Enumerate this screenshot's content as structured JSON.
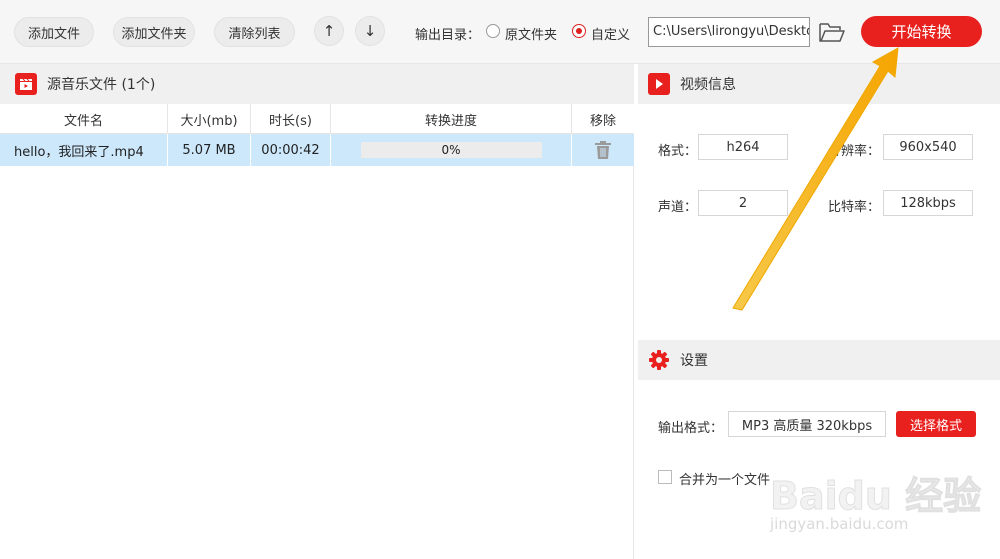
{
  "toolbar": {
    "add_file": "添加文件",
    "add_folder": "添加文件夹",
    "clear_list": "清除列表",
    "move_up_icon": "arrow-up-icon",
    "move_down_icon": "arrow-down-icon",
    "output_dir_label": "输出目录：",
    "radio_original": "原文件夹",
    "radio_custom": "自定义",
    "selected_radio": "custom",
    "output_path": "C:\\Users\\lirongyu\\Desktop",
    "folder_icon": "folder-open-icon",
    "start_button": "开始转换"
  },
  "source_files": {
    "title": "源音乐文件 (1个)",
    "icon": "video-clapper-icon",
    "columns": [
      "文件名",
      "大小(mb)",
      "时长(s)",
      "转换进度",
      "移除"
    ],
    "rows": [
      {
        "name": "hello，我回来了.mp4",
        "size": "5.07 MB",
        "duration": "00:00:42",
        "progress_text": "0%",
        "progress": 0,
        "remove_icon": "trash-icon"
      }
    ]
  },
  "video_info": {
    "title": "视频信息",
    "icon": "play-icon",
    "format_label": "格式：",
    "format_value": "h264",
    "resolution_label": "分辨率：",
    "resolution_value": "960x540",
    "channels_label": "声道：",
    "channels_value": "2",
    "bitrate_label": "比特率：",
    "bitrate_value": "128kbps"
  },
  "settings": {
    "title": "设置",
    "icon": "gear-icon",
    "output_format_label": "输出格式：",
    "output_format_value": "MP3 高质量 320kbps",
    "choose_format_button": "选择格式",
    "merge_label": "合并为一个文件",
    "merge_checked": false
  },
  "watermark": {
    "brand": "Baidu 经验",
    "url": "jingyan.baidu.com"
  },
  "colors": {
    "accent": "#e8201e",
    "selected_row": "#cde8fb",
    "annotation_arrow": "#f5b400"
  }
}
